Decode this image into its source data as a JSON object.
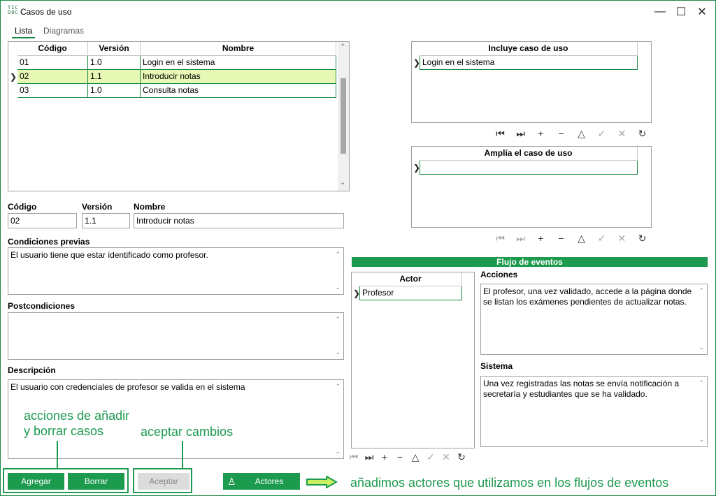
{
  "window": {
    "logo_text": "TIC\nDOC",
    "title": "Casos de uso",
    "minimize_glyph": "—",
    "maximize_glyph": "☐",
    "close_glyph": "✕"
  },
  "tabs": [
    {
      "label": "Lista"
    },
    {
      "label": "Diagramas"
    }
  ],
  "cases_grid": {
    "headers": [
      "Código",
      "Versión",
      "Nombre"
    ],
    "rows": [
      {
        "codigo": "01",
        "version": "1.0",
        "nombre": "Login en el sistema"
      },
      {
        "codigo": "02",
        "version": "1.1",
        "nombre": "Introducir notas"
      },
      {
        "codigo": "03",
        "version": "1.0",
        "nombre": "Consulta notas"
      }
    ],
    "selected_index": 1
  },
  "form": {
    "codigo_label": "Código",
    "codigo_value": "02",
    "version_label": "Versión",
    "version_value": "1.1",
    "nombre_label": "Nombre",
    "nombre_value": "Introducir notas",
    "precond_label": "Condiciones previas",
    "precond_value": "El usuario tiene que estar identificado como profesor.",
    "postcond_label": "Postcondiciones",
    "postcond_value": "",
    "desc_label": "Descripción",
    "desc_value": "El usuario con credenciales de profesor se valida en el sistema"
  },
  "includes": {
    "header": "Incluye caso de uso",
    "rows": [
      "Login en el sistema"
    ]
  },
  "extends": {
    "header": "Amplía el caso de uso",
    "rows": [
      ""
    ]
  },
  "nav_icons": {
    "first": "⏮",
    "last": "⏭",
    "add": "+",
    "remove": "−",
    "up": "△",
    "confirm": "✓",
    "cancel": "✕",
    "refresh": "↻"
  },
  "flow": {
    "banner": "Flujo de eventos",
    "actor_header": "Actor",
    "actor_rows": [
      "Profesor"
    ],
    "acciones_label": "Acciones",
    "acciones_value": "El profesor, una vez validado, accede a la página donde se listan los exámenes pendientes de actualizar notas.",
    "sistema_label": "Sistema",
    "sistema_value": "Una vez registradas las notas se envía notificación a secretaría y estudiantes que se ha validado."
  },
  "buttons": {
    "agregar": "Agregar",
    "borrar": "Borrar",
    "aceptar": "Aceptar",
    "actores": "Actores"
  },
  "annotations": {
    "add_delete": "acciones de añadir\ny borrar casos",
    "accept": "aceptar cambios",
    "actors": "añadimos actores que utilizamos en los flujos de eventos"
  },
  "colors": {
    "accent": "#1c9a4e",
    "selected_row": "#e6f8b4",
    "border_green": "#1c8a46"
  }
}
